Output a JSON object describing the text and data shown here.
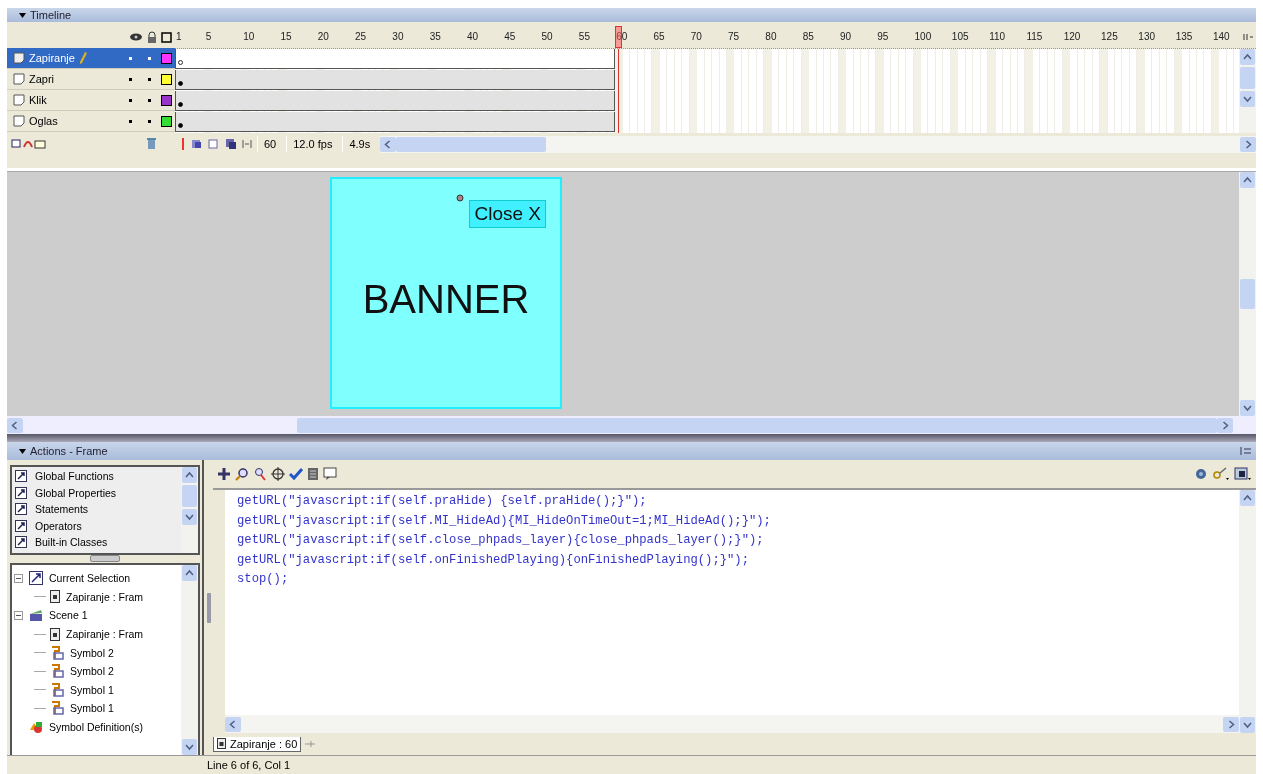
{
  "timeline": {
    "title": "Timeline",
    "ruler": [
      "1",
      "5",
      "10",
      "15",
      "20",
      "25",
      "30",
      "35",
      "40",
      "45",
      "50",
      "55",
      "60",
      "65",
      "70",
      "75",
      "80",
      "85",
      "90",
      "95",
      "100",
      "105",
      "110",
      "115",
      "120",
      "125",
      "130",
      "135",
      "140"
    ],
    "layers": [
      {
        "name": "Zapiranje",
        "selected": true,
        "color": "#ff33ff",
        "empty_keyframe": true
      },
      {
        "name": "Zapri",
        "selected": false,
        "color": "#ffff33",
        "empty_keyframe": false
      },
      {
        "name": "Klik",
        "selected": false,
        "color": "#9933cc",
        "empty_keyframe": false
      },
      {
        "name": "Oglas",
        "selected": false,
        "color": "#33dd33",
        "empty_keyframe": false
      }
    ],
    "current_frame": "60",
    "frame_rate": "12.0 fps",
    "elapsed": "4.9s"
  },
  "stage": {
    "banner_text": "BANNER",
    "close_button": "Close X"
  },
  "actions": {
    "title": "Actions - Frame",
    "toolbox": [
      "Global Functions",
      "Global Properties",
      "Statements",
      "Operators",
      "Built-in Classes"
    ],
    "tree": [
      {
        "label": "Current Selection",
        "kind": "selection",
        "children": [
          {
            "label": "Zapiranje : Fram",
            "kind": "frame"
          }
        ]
      },
      {
        "label": "Scene 1",
        "kind": "scene",
        "children": [
          {
            "label": "Zapiranje : Fram",
            "kind": "frame"
          },
          {
            "label": "Symbol 2",
            "kind": "symbol"
          },
          {
            "label": "Symbol 2",
            "kind": "symbol"
          },
          {
            "label": "Symbol 1",
            "kind": "symbol"
          },
          {
            "label": "Symbol 1",
            "kind": "symbol"
          }
        ]
      },
      {
        "label": "Symbol Definition(s)",
        "kind": "definition"
      }
    ],
    "code": [
      "getURL(\"javascript:if(self.praHide) {self.praHide();}\");",
      "getURL(\"javascript:if(self.MI_HideAd){MI_HideOnTimeOut=1;MI_HideAd();}\");",
      "getURL(\"javascript:if(self.close_phpads_layer){close_phpads_layer();}\");",
      "getURL(\"javascript:if(self.onFinishedPlaying){onFinishedPlaying();}\");",
      "stop();"
    ],
    "script_tab": "Zapiranje : 60",
    "status": "Line 6 of 6, Col 1"
  }
}
